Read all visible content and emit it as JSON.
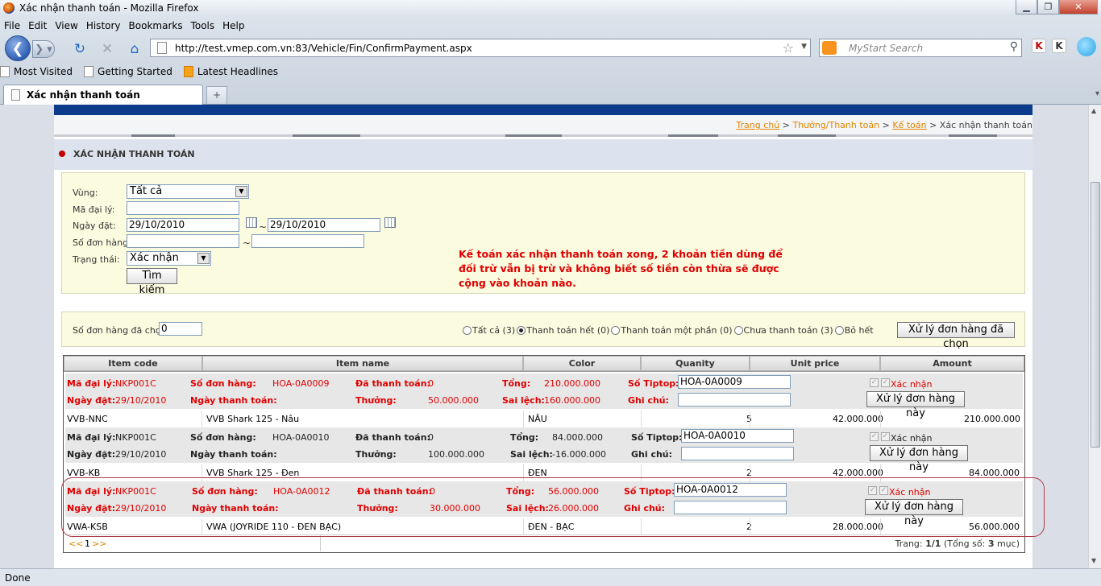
{
  "window": {
    "title": "Xác nhận thanh toán - Mozilla Firefox"
  },
  "menu": [
    "File",
    "Edit",
    "View",
    "History",
    "Bookmarks",
    "Tools",
    "Help"
  ],
  "url": "http://test.vmep.com.vn:83/Vehicle/Fin/ConfirmPayment.aspx",
  "search_placeholder": "MyStart Search",
  "bookmarks": [
    "Most Visited",
    "Getting Started",
    "Latest Headlines"
  ],
  "tab": {
    "title": "Xác nhận thanh toán",
    "new": "+"
  },
  "status": "Done",
  "breadcrumb": {
    "home": "Trang chủ",
    "sep": ">",
    "reward": "Thưởng/Thanh toán",
    "accounting": "Kế toán",
    "current": "Xác nhận thanh toán"
  },
  "page_title": "XÁC NHẬN THANH TOÁN",
  "filter": {
    "region_label": "Vùng:",
    "region_value": "Tất cả",
    "dealer_label": "Mã đại lý:",
    "date_label": "Ngày đặt:",
    "date_from": "29/10/2010",
    "date_to": "29/10/2010",
    "tilde": "~",
    "order_label": "Số đơn hàng:",
    "status_label": "Trạng thái:",
    "status_value": "Xác nhận",
    "search_button": "Tìm kiếm"
  },
  "note": "Kế toán xác nhận thanh toán xong, 2 khoản tiền dùng để đối trừ vẫn bị trừ và không biết số tiền còn thừa sẽ được cộng vào khoản nào.",
  "actions": {
    "selected_label": "Số đơn hàng đã chọn:",
    "selected_value": "0",
    "radios": [
      "Tất cả (3)",
      "Thanh toán hết (0)",
      "Thanh toán một phần (0)",
      "Chưa thanh toán (3)",
      "Bỏ hết"
    ],
    "process_selected": "Xử lý đơn hàng đã chọn"
  },
  "columns": [
    "Item code",
    "Item name",
    "Color",
    "Quanity",
    "Unit price",
    "Amount"
  ],
  "labels": {
    "dealer": "Mã đại lý:",
    "order_no": "Số đơn hàng:",
    "paid": "Đã thanh toán:",
    "total": "Tổng:",
    "tiptop": "Số Tiptop:",
    "order_date": "Ngày đặt:",
    "pay_date": "Ngày thanh toán:",
    "reward": "Thưởng:",
    "diff": "Sai lệch:",
    "note": "Ghi chú:",
    "confirm": "Xác nhận",
    "process": "Xử lý đơn hàng này"
  },
  "orders": [
    {
      "dealer": "NKP001C",
      "order_no": "HOA-0A0009",
      "paid": "0",
      "total": "210.000.000",
      "tiptop": "HOA-0A0009",
      "date": "29/10/2010",
      "reward": "50.000.000",
      "diff": "160.000.000",
      "item": {
        "code": "VVB-NNC",
        "name": "VVB Shark 125 - Nâu",
        "color": "NÂU",
        "qty": "5",
        "price": "42.000.000",
        "amount": "210.000.000"
      }
    },
    {
      "dealer": "NKP001C",
      "order_no": "HOA-0A0010",
      "paid": "0",
      "total": "84.000.000",
      "tiptop": "HOA-0A0010",
      "date": "29/10/2010",
      "reward": "100.000.000",
      "diff": "-16.000.000",
      "item": {
        "code": "VVB-KB",
        "name": "VVB Shark 125 - Đen",
        "color": "ĐEN",
        "qty": "2",
        "price": "42.000.000",
        "amount": "84.000.000"
      }
    },
    {
      "dealer": "NKP001C",
      "order_no": "HOA-0A0012",
      "paid": "0",
      "total": "56.000.000",
      "tiptop": "HOA-0A0012",
      "date": "29/10/2010",
      "reward": "30.000.000",
      "diff": "26.000.000",
      "item": {
        "code": "VWA-KSB",
        "name": "VWA (JOYRIDE 110 - ĐEN BẠC)",
        "color": "ĐEN - BẠC",
        "qty": "2",
        "price": "28.000.000",
        "amount": "56.000.000"
      }
    }
  ],
  "pager": {
    "prev": "<<",
    "page": "1",
    "next": ">>",
    "info_prefix": "Trang: ",
    "info_page": "1/1",
    "info_mid": " (Tổng số: ",
    "info_count": "3",
    "info_suffix": " mục)"
  }
}
